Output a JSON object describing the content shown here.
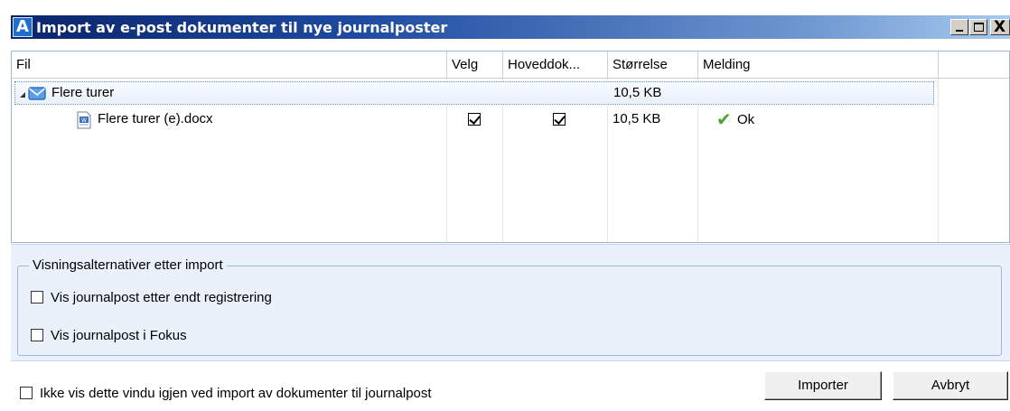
{
  "window": {
    "app_icon_letter": "A",
    "title": "Import av e-post dokumenter til nye journalposter",
    "close_glyph": "X"
  },
  "grid": {
    "columns": [
      "Fil",
      "Velg",
      "Hoveddok...",
      "Størrelse",
      "Melding"
    ],
    "parent_row": {
      "name": "Flere turer",
      "size": "10,5 KB",
      "icon": "envelope-icon"
    },
    "child_row": {
      "name": "Flere turer  (e).docx",
      "velg": true,
      "hoveddok": true,
      "size": "10,5 KB",
      "status_icon": "checkmark-icon",
      "message": "Ok",
      "icon": "word-document-icon"
    }
  },
  "options": {
    "legend": "Visningsalternativer etter import",
    "show_after_registration": {
      "label": "Vis journalpost etter endt registrering",
      "checked": false
    },
    "show_in_focus": {
      "label": "Vis journalpost i Fokus",
      "checked": false
    }
  },
  "footer": {
    "dont_show_again": {
      "label": "Ikke vis dette vindu igjen ved import av dokumenter til journalpost",
      "checked": false
    },
    "import_button": "Importer",
    "cancel_button": "Avbryt"
  },
  "colors": {
    "title_gradient_start": "#0a246a",
    "title_gradient_end": "#a6caf0",
    "panel_bg": "#eaf1fb",
    "ok_green": "#4aa52e"
  }
}
